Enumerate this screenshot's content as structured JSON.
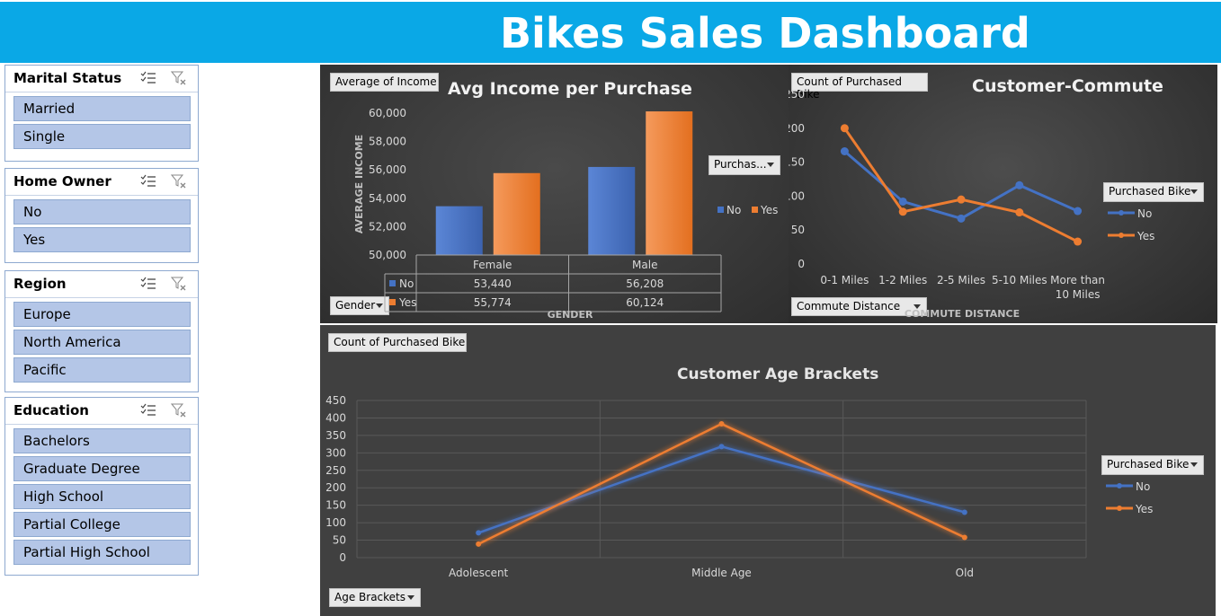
{
  "title": "Bikes Sales Dashboard",
  "colors": {
    "header": "#0aa8e6",
    "no": "#4472c4",
    "yes": "#ed7d31",
    "panel": "#404040",
    "slicer_item": "#b4c6e7"
  },
  "slicers": [
    {
      "title": "Marital Status",
      "items": [
        "Married",
        "Single"
      ]
    },
    {
      "title": "Home Owner",
      "items": [
        "No",
        "Yes"
      ]
    },
    {
      "title": "Region",
      "items": [
        "Europe",
        "North America",
        "Pacific"
      ]
    },
    {
      "title": "Education",
      "items": [
        "Bachelors",
        "Graduate Degree",
        "High School",
        "Partial College",
        "Partial High School"
      ]
    }
  ],
  "slicer_icons": [
    "multi-select-icon",
    "clear-filter-icon"
  ],
  "income_panel": {
    "value_button": "Average of Income",
    "legend_button": "Purchas...",
    "axis_button": "Gender"
  },
  "commute_panel": {
    "value_button": "Count of Purchased Bike",
    "legend_button": "Purchased Bike",
    "axis_button": "Commute Distance"
  },
  "age_panel": {
    "value_button": "Count of Purchased Bike",
    "legend_button": "Purchased Bike",
    "axis_button": "Age Brackets"
  },
  "chart_data": [
    {
      "type": "bar",
      "title": "Avg Income per Purchase",
      "xlabel": "GENDER",
      "ylabel": "AVERAGE INCOME",
      "categories": [
        "Female",
        "Male"
      ],
      "series": [
        {
          "name": "No",
          "values": [
            53440,
            56208
          ],
          "labels": [
            "53,440",
            "56,208"
          ]
        },
        {
          "name": "Yes",
          "values": [
            55774,
            60124
          ],
          "labels": [
            "55,774",
            "60,124"
          ]
        }
      ],
      "ylim": [
        50000,
        60000
      ],
      "yticks": [
        "50,000",
        "52,000",
        "54,000",
        "56,000",
        "58,000",
        "60,000"
      ],
      "data_table": true,
      "legend": "right"
    },
    {
      "type": "line",
      "title": "Customer-Commute",
      "xlabel": "COMMUTE DISTANCE",
      "categories": [
        "0-1 Miles",
        "1-2 Miles",
        "2-5 Miles",
        "5-10 Miles",
        "More than 10 Miles"
      ],
      "series": [
        {
          "name": "No",
          "values": [
            166,
            92,
            67,
            116,
            78
          ]
        },
        {
          "name": "Yes",
          "values": [
            200,
            77,
            95,
            76,
            33
          ]
        }
      ],
      "ylim": [
        0,
        250
      ],
      "yticks": [
        "0",
        "50",
        "100",
        "150",
        "200",
        "250"
      ],
      "legend": "right"
    },
    {
      "type": "line",
      "title": "Customer Age Brackets",
      "categories": [
        "Adolescent",
        "Middle Age",
        "Old"
      ],
      "series": [
        {
          "name": "No",
          "values": [
            71,
            318,
            130
          ]
        },
        {
          "name": "Yes",
          "values": [
            39,
            383,
            58
          ]
        }
      ],
      "ylim": [
        0,
        450
      ],
      "yticks": [
        "0",
        "50",
        "100",
        "150",
        "200",
        "250",
        "300",
        "350",
        "400",
        "450"
      ],
      "legend": "right"
    }
  ]
}
